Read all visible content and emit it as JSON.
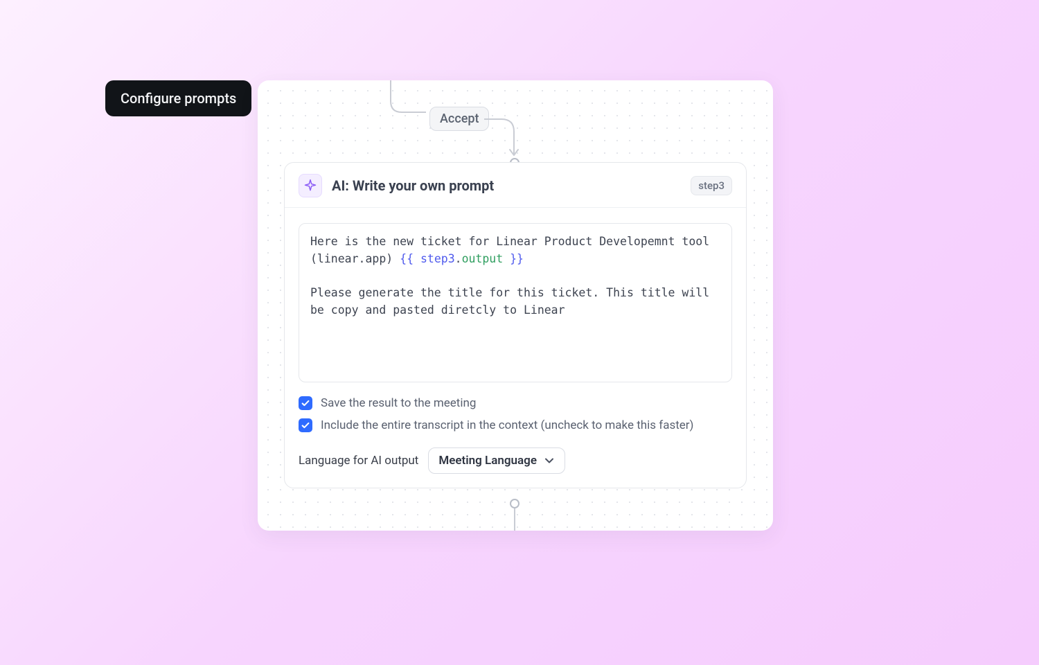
{
  "float_label": "Configure prompts",
  "accept_label": "Accept",
  "card": {
    "title": "AI: Write your own prompt",
    "step_badge": "step3",
    "prompt": {
      "line1_pre": "Here is the new ticket for Linear Product Developemnt tool (linear.app) ",
      "brace_open": "{{ ",
      "var_step": "step3",
      "var_dot": ".",
      "var_out": "output",
      "brace_close": " }}",
      "line2": "Please generate the title for this ticket. This title will be copy and pasted diretcly to Linear"
    },
    "check1_label": "Save the result to the meeting",
    "check2_label": "Include the entire transcript in the context (uncheck to make this faster)",
    "lang_label": "Language for AI output",
    "lang_value": "Meeting Language"
  }
}
